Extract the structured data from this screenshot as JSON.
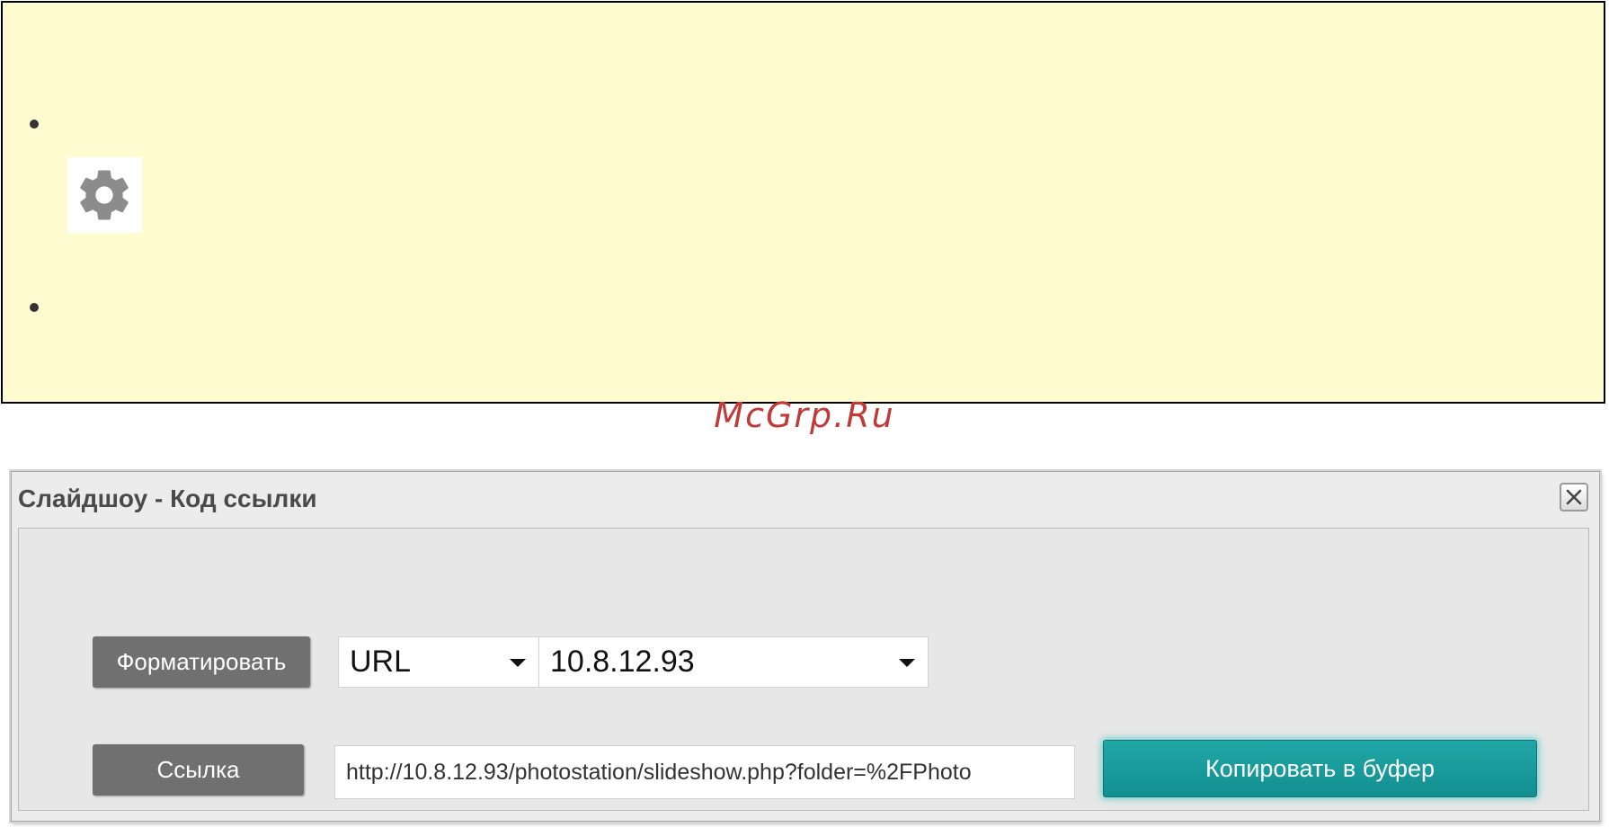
{
  "watermark": "McGrp.Ru",
  "note_panel": {
    "background_color": "#fffbd0",
    "icon": "gear-icon"
  },
  "dialog": {
    "title": "Слайдшоу - Код ссылки",
    "close_icon": "close-icon",
    "format_label": "Форматировать",
    "format_select": {
      "selected": "URL"
    },
    "host_select": {
      "selected": "10.8.12.93"
    },
    "link_label": "Ссылка",
    "link_value": "http://10.8.12.93/photostation/slideshow.php?folder=%2FPhoto",
    "copy_button_label": "Копировать в буфер",
    "accent_color": "#1a9c9d"
  }
}
